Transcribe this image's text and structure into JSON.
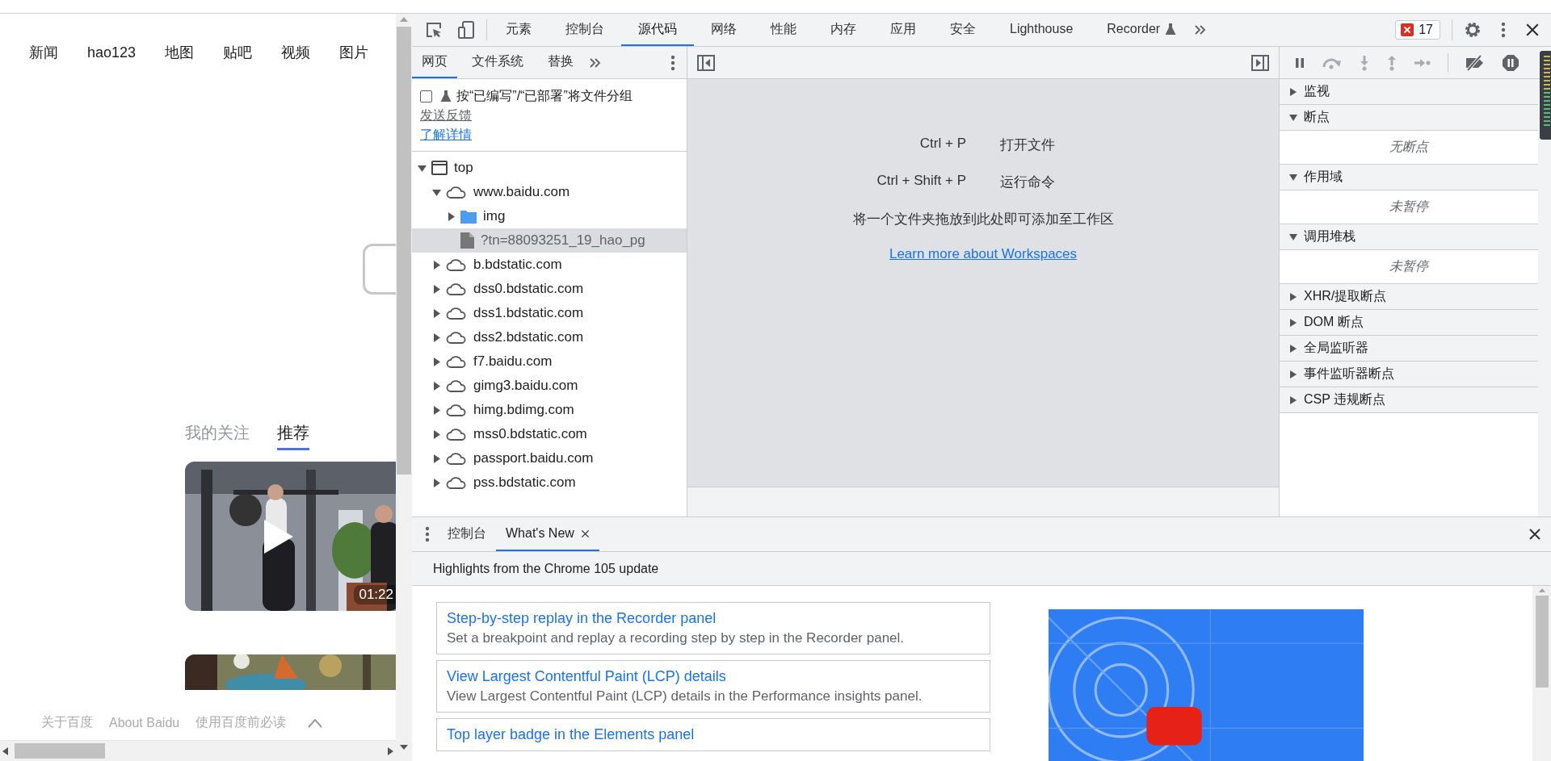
{
  "browser_page": {
    "nav_links": [
      "新闻",
      "hao123",
      "地图",
      "贴吧",
      "视频",
      "图片"
    ],
    "feed_tabs": [
      {
        "label": "我的关注",
        "selected": false
      },
      {
        "label": "推荐",
        "selected": true
      }
    ],
    "videos": [
      {
        "kind": "picture",
        "duration": "01:22"
      },
      {
        "kind": "picture"
      }
    ],
    "footer_links": [
      "关于百度",
      "About Baidu",
      "使用百度前必读"
    ]
  },
  "devtools": {
    "main_tabs": [
      {
        "label": "元素",
        "selected": false,
        "experimental": false
      },
      {
        "label": "控制台",
        "selected": false,
        "experimental": false
      },
      {
        "label": "源代码",
        "selected": true,
        "experimental": false
      },
      {
        "label": "网络",
        "selected": false,
        "experimental": false
      },
      {
        "label": "性能",
        "selected": false,
        "experimental": false
      },
      {
        "label": "内存",
        "selected": false,
        "experimental": false
      },
      {
        "label": "应用",
        "selected": false,
        "experimental": false
      },
      {
        "label": "安全",
        "selected": false,
        "experimental": false
      },
      {
        "label": "Lighthouse",
        "selected": false,
        "experimental": false
      },
      {
        "label": "Recorder",
        "selected": false,
        "experimental": true
      }
    ],
    "error_count": "17",
    "navigator": {
      "tabs": [
        {
          "label": "网页",
          "selected": true
        },
        {
          "label": "文件系统",
          "selected": false
        },
        {
          "label": "替换",
          "selected": false
        }
      ],
      "group_option": {
        "label": "按“已编写”/“已部署”将文件分组",
        "checked": false
      },
      "feedback_link": "发送反馈",
      "learn_link": "了解详情",
      "tree": [
        {
          "label": "top",
          "kind": "frame",
          "expanded": true,
          "selected": false,
          "children": [
            {
              "label": "www.baidu.com",
              "kind": "domain",
              "expanded": true,
              "selected": false,
              "children": [
                {
                  "label": "img",
                  "kind": "folder",
                  "expanded": false,
                  "selected": false
                },
                {
                  "label": "?tn=88093251_19_hao_pg",
                  "kind": "file",
                  "selected": true
                }
              ]
            },
            {
              "label": "b.bdstatic.com",
              "kind": "domain",
              "expanded": false,
              "selected": false
            },
            {
              "label": "dss0.bdstatic.com",
              "kind": "domain",
              "expanded": false,
              "selected": false
            },
            {
              "label": "dss1.bdstatic.com",
              "kind": "domain",
              "expanded": false,
              "selected": false
            },
            {
              "label": "dss2.bdstatic.com",
              "kind": "domain",
              "expanded": false,
              "selected": false
            },
            {
              "label": "f7.baidu.com",
              "kind": "domain",
              "expanded": false,
              "selected": false
            },
            {
              "label": "gimg3.baidu.com",
              "kind": "domain",
              "expanded": false,
              "selected": false
            },
            {
              "label": "himg.bdimg.com",
              "kind": "domain",
              "expanded": false,
              "selected": false
            },
            {
              "label": "mss0.bdstatic.com",
              "kind": "domain",
              "expanded": false,
              "selected": false
            },
            {
              "label": "passport.baidu.com",
              "kind": "domain",
              "expanded": false,
              "selected": false
            },
            {
              "label": "pss.bdstatic.com",
              "kind": "domain",
              "expanded": false,
              "selected": false
            }
          ]
        }
      ]
    },
    "editor": {
      "shortcuts": [
        {
          "keys": "Ctrl + P",
          "action": "打开文件"
        },
        {
          "keys": "Ctrl + Shift + P",
          "action": "运行命令"
        }
      ],
      "drop_hint": "将一个文件夹拖放到此处即可添加至工作区",
      "learn_more": "Learn more about Workspaces"
    },
    "debugger": {
      "sections": [
        {
          "title": "监视",
          "expanded": false
        },
        {
          "title": "断点",
          "expanded": true,
          "empty_text": "无断点"
        },
        {
          "title": "作用域",
          "expanded": true,
          "empty_text": "未暂停"
        },
        {
          "title": "调用堆栈",
          "expanded": true,
          "empty_text": "未暂停"
        },
        {
          "title": "XHR/提取断点",
          "expanded": false
        },
        {
          "title": "DOM 断点",
          "expanded": false
        },
        {
          "title": "全局监听器",
          "expanded": false
        },
        {
          "title": "事件监听器断点",
          "expanded": false
        },
        {
          "title": "CSP 违规断点",
          "expanded": false
        }
      ]
    },
    "drawer": {
      "tabs": [
        {
          "label": "控制台",
          "selected": false,
          "closable": false
        },
        {
          "label": "What's New",
          "selected": true,
          "closable": true
        }
      ],
      "heading": "Highlights from the Chrome 105 update",
      "articles": [
        {
          "title": "Step-by-step replay in the Recorder panel",
          "description": "Set a breakpoint and replay a recording step by step in the Recorder panel."
        },
        {
          "title": "View Largest Contentful Paint (LCP) details",
          "description": "View Largest Contentful Paint (LCP) details in the Performance insights panel."
        },
        {
          "title": "Top layer badge in the Elements panel"
        }
      ],
      "video": {
        "kind": "picture"
      }
    }
  }
}
